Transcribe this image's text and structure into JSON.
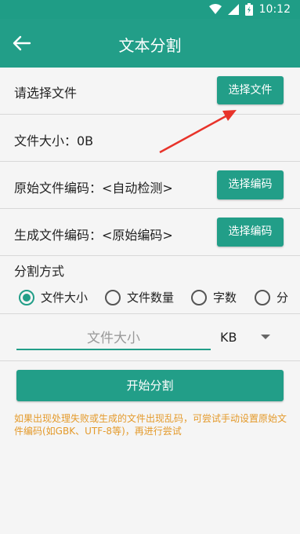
{
  "statusbar": {
    "time": "10:12"
  },
  "appbar": {
    "title": "文本分割"
  },
  "file_row": {
    "label": "请选择文件",
    "button": "选择文件"
  },
  "size_row": {
    "label": "文件大小：0B"
  },
  "src_encoding_row": {
    "label": "原始文件编码：<自动检测>",
    "button": "选择编码"
  },
  "out_encoding_row": {
    "label": "生成文件编码：<原始编码>",
    "button": "选择编码"
  },
  "split_mode": {
    "title": "分割方式",
    "options": [
      "文件大小",
      "文件数量",
      "字数",
      "分"
    ],
    "selected": "文件大小"
  },
  "size_field": {
    "placeholder": "文件大小",
    "unit": "KB"
  },
  "start_button": "开始分割",
  "note": "如果出现处理失败或生成的文件出现乱码，可尝试手动设置原始文件编码(如GBK、UTF-8等)，再进行尝试",
  "colors": {
    "accent": "#229e88",
    "note": "#e49a2b",
    "annotation_arrow": "#e8332a"
  }
}
